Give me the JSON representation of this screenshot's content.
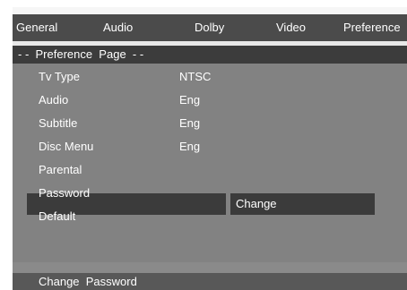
{
  "tabs": [
    "General",
    "Audio",
    "Dolby",
    "Video",
    "Preference"
  ],
  "page_header": "- -  Preference  Page  - -",
  "menu_items": [
    {
      "label": "Tv Type",
      "value": "NTSC"
    },
    {
      "label": "Audio",
      "value": "Eng"
    },
    {
      "label": "Subtitle",
      "value": "Eng"
    },
    {
      "label": "Disc Menu",
      "value": "Eng"
    },
    {
      "label": "Parental",
      "value": ""
    },
    {
      "label": "Password",
      "value": ""
    },
    {
      "label": "Default",
      "value": ""
    }
  ],
  "selected_item": "Password",
  "submenu_option": "Change",
  "status_text": "Change  Password"
}
